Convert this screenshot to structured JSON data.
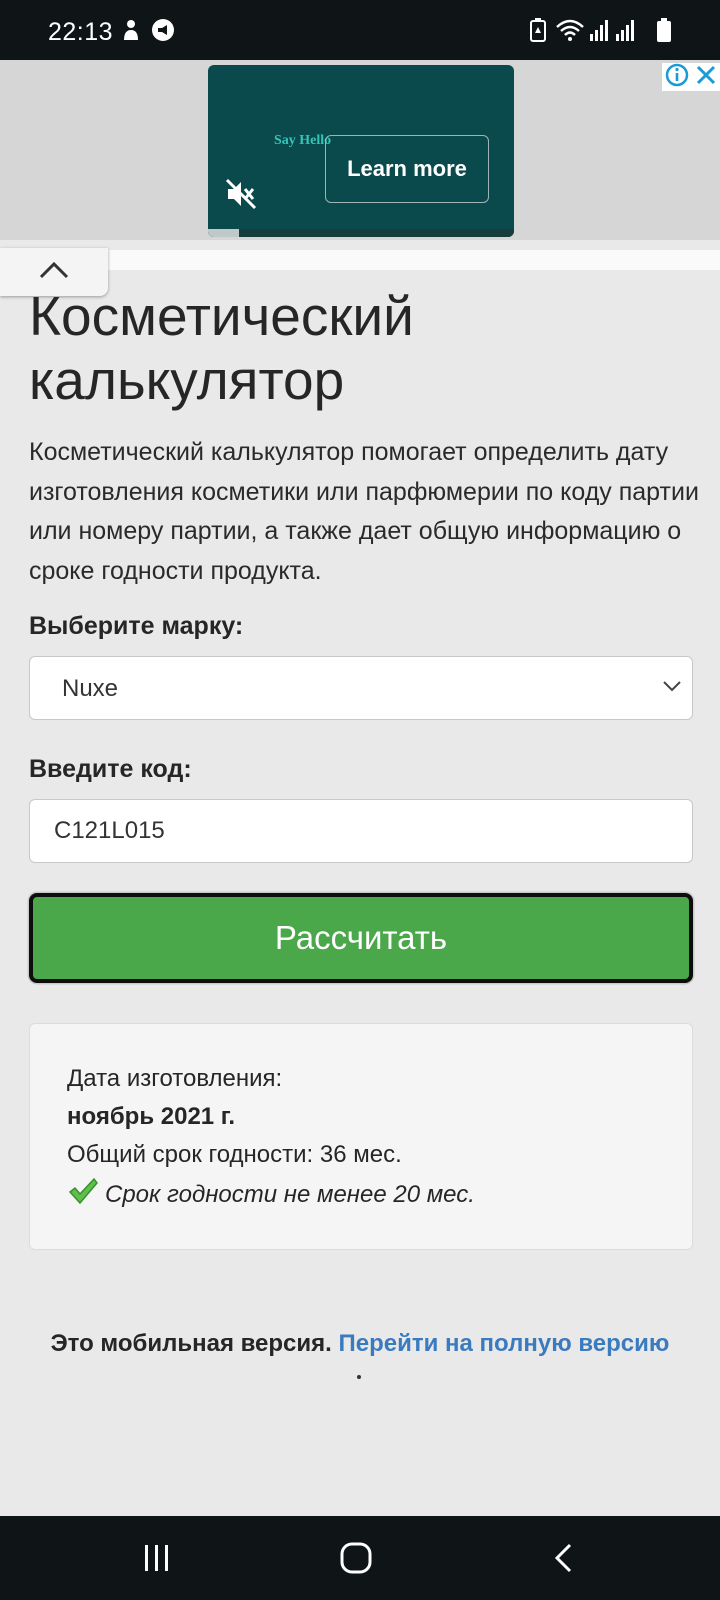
{
  "status_bar": {
    "time": "22:13",
    "icons": [
      "person-silhouette-icon",
      "megaphone-icon",
      "battery-saver-icon",
      "wifi-icon",
      "signal-icon",
      "signal-icon",
      "battery-icon"
    ]
  },
  "ad": {
    "brand_text": "Say Hello",
    "cta_label": "Learn more",
    "progress": 0.1,
    "icons": [
      "mute-icon",
      "info-icon",
      "close-icon"
    ],
    "colors": {
      "background": "#0a4a4c",
      "brand": "#33c6b8"
    }
  },
  "main": {
    "title": "Косметический калькулятор",
    "intro": "Косметический калькулятор помогает определить дату изготовления косметики или парфюмерии по коду партии или номеру партии, а также дает общую информацию о сроке годности продукта.",
    "brand_label": "Выберите марку:",
    "brand_value": "Nuxe",
    "code_label": "Введите код:",
    "code_value": "C121L015",
    "button_label": "Рассчитать"
  },
  "result": {
    "date_label": "Дата изготовления:",
    "date_value": "ноябрь 2021 г.",
    "total_shelf_life": "Общий срок годности: 36 мес.",
    "remaining_note": "Срок годности не менее 20 мес.",
    "check_icon": "checkmark-icon"
  },
  "footer": {
    "text": "Это мобильная версия.",
    "link": "Перейти на полную версию"
  },
  "nav_bar": {
    "icons": [
      "recents-icon",
      "home-icon",
      "back-icon"
    ]
  },
  "colors": {
    "accent_button": "#4aa84a",
    "link": "#3a7bbf",
    "page_background": "#e9e9e9"
  }
}
